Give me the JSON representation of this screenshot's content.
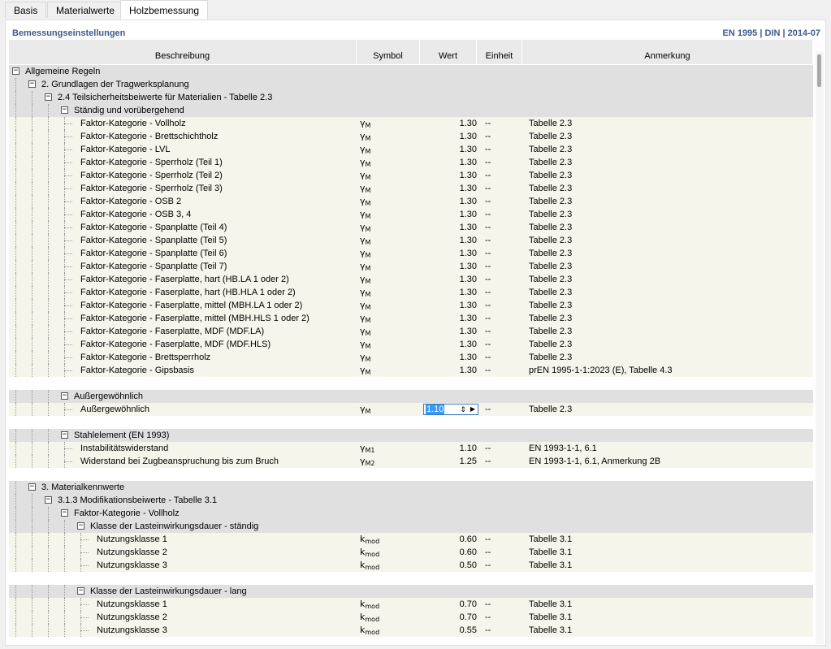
{
  "tabs": [
    {
      "label": "Basis",
      "active": false
    },
    {
      "label": "Materialwerte",
      "active": false
    },
    {
      "label": "Holzbemessung",
      "active": true
    }
  ],
  "panel": {
    "title": "Bemessungseinstellungen",
    "norm": "EN 1995 | DIN | 2014-07"
  },
  "columns": {
    "desc": "Beschreibung",
    "symbol": "Symbol",
    "value": "Wert",
    "unit": "Einheit",
    "note": "Anmerkung"
  },
  "rows": [
    {
      "type": "group",
      "level": 0,
      "text": "Allgemeine Regeln"
    },
    {
      "type": "group",
      "level": 1,
      "text": "2. Grundlagen der Tragwerksplanung"
    },
    {
      "type": "group",
      "level": 2,
      "text": "2.4 Teilsicherheitsbeiwerte für Materialien - Tabelle 2.3"
    },
    {
      "type": "group",
      "level": 3,
      "text": "Ständig und vorübergehend"
    },
    {
      "type": "data",
      "level": 4,
      "text": "Faktor-Kategorie - Vollholz",
      "sym": "γ",
      "sub": "M",
      "val": "1.30",
      "unit": "--",
      "note": "Tabelle 2.3"
    },
    {
      "type": "data",
      "level": 4,
      "text": "Faktor-Kategorie - Brettschichtholz",
      "sym": "γ",
      "sub": "M",
      "val": "1.30",
      "unit": "--",
      "note": "Tabelle 2.3"
    },
    {
      "type": "data",
      "level": 4,
      "text": "Faktor-Kategorie - LVL",
      "sym": "γ",
      "sub": "M",
      "val": "1.30",
      "unit": "--",
      "note": "Tabelle 2.3"
    },
    {
      "type": "data",
      "level": 4,
      "text": "Faktor-Kategorie - Sperrholz (Teil 1)",
      "sym": "γ",
      "sub": "M",
      "val": "1.30",
      "unit": "--",
      "note": "Tabelle 2.3"
    },
    {
      "type": "data",
      "level": 4,
      "text": "Faktor-Kategorie - Sperrholz (Teil 2)",
      "sym": "γ",
      "sub": "M",
      "val": "1.30",
      "unit": "--",
      "note": "Tabelle 2.3"
    },
    {
      "type": "data",
      "level": 4,
      "text": "Faktor-Kategorie - Sperrholz (Teil 3)",
      "sym": "γ",
      "sub": "M",
      "val": "1.30",
      "unit": "--",
      "note": "Tabelle 2.3"
    },
    {
      "type": "data",
      "level": 4,
      "text": "Faktor-Kategorie - OSB 2",
      "sym": "γ",
      "sub": "M",
      "val": "1.30",
      "unit": "--",
      "note": "Tabelle 2.3"
    },
    {
      "type": "data",
      "level": 4,
      "text": "Faktor-Kategorie - OSB 3, 4",
      "sym": "γ",
      "sub": "M",
      "val": "1.30",
      "unit": "--",
      "note": "Tabelle 2.3"
    },
    {
      "type": "data",
      "level": 4,
      "text": "Faktor-Kategorie - Spanplatte (Teil 4)",
      "sym": "γ",
      "sub": "M",
      "val": "1.30",
      "unit": "--",
      "note": "Tabelle 2.3"
    },
    {
      "type": "data",
      "level": 4,
      "text": "Faktor-Kategorie - Spanplatte (Teil 5)",
      "sym": "γ",
      "sub": "M",
      "val": "1.30",
      "unit": "--",
      "note": "Tabelle 2.3"
    },
    {
      "type": "data",
      "level": 4,
      "text": "Faktor-Kategorie - Spanplatte (Teil 6)",
      "sym": "γ",
      "sub": "M",
      "val": "1.30",
      "unit": "--",
      "note": "Tabelle 2.3"
    },
    {
      "type": "data",
      "level": 4,
      "text": "Faktor-Kategorie - Spanplatte (Teil 7)",
      "sym": "γ",
      "sub": "M",
      "val": "1.30",
      "unit": "--",
      "note": "Tabelle 2.3"
    },
    {
      "type": "data",
      "level": 4,
      "text": "Faktor-Kategorie - Faserplatte, hart (HB.LA 1 oder 2)",
      "sym": "γ",
      "sub": "M",
      "val": "1.30",
      "unit": "--",
      "note": "Tabelle 2.3"
    },
    {
      "type": "data",
      "level": 4,
      "text": "Faktor-Kategorie - Faserplatte, hart (HB.HLA 1 oder 2)",
      "sym": "γ",
      "sub": "M",
      "val": "1.30",
      "unit": "--",
      "note": "Tabelle 2.3"
    },
    {
      "type": "data",
      "level": 4,
      "text": "Faktor-Kategorie - Faserplatte, mittel (MBH.LA 1 oder 2)",
      "sym": "γ",
      "sub": "M",
      "val": "1.30",
      "unit": "--",
      "note": "Tabelle 2.3"
    },
    {
      "type": "data",
      "level": 4,
      "text": "Faktor-Kategorie - Faserplatte, mittel (MBH.HLS 1 oder 2)",
      "sym": "γ",
      "sub": "M",
      "val": "1.30",
      "unit": "--",
      "note": "Tabelle 2.3"
    },
    {
      "type": "data",
      "level": 4,
      "text": "Faktor-Kategorie - Faserplatte, MDF (MDF.LA)",
      "sym": "γ",
      "sub": "M",
      "val": "1.30",
      "unit": "--",
      "note": "Tabelle 2.3"
    },
    {
      "type": "data",
      "level": 4,
      "text": "Faktor-Kategorie - Faserplatte, MDF (MDF.HLS)",
      "sym": "γ",
      "sub": "M",
      "val": "1.30",
      "unit": "--",
      "note": "Tabelle 2.3"
    },
    {
      "type": "data",
      "level": 4,
      "text": "Faktor-Kategorie - Brettsperrholz",
      "sym": "γ",
      "sub": "M",
      "val": "1.30",
      "unit": "--",
      "note": "Tabelle 2.3"
    },
    {
      "type": "data",
      "level": 4,
      "text": "Faktor-Kategorie - Gipsbasis",
      "sym": "γ",
      "sub": "M",
      "val": "1.30",
      "unit": "--",
      "note": "prEN 1995-1-1:2023 (E), Tabelle 4.3"
    },
    {
      "type": "spacer"
    },
    {
      "type": "group",
      "level": 3,
      "text": "Außergewöhnlich"
    },
    {
      "type": "data",
      "level": 4,
      "text": "Außergewöhnlich",
      "sym": "γ",
      "sub": "M",
      "val": "1.10",
      "unit": "--",
      "note": "Tabelle 2.3",
      "editing": true
    },
    {
      "type": "spacer"
    },
    {
      "type": "group",
      "level": 3,
      "text": "Stahlelement (EN 1993)"
    },
    {
      "type": "data",
      "level": 4,
      "text": "Instabilitätswiderstand",
      "sym": "γ",
      "sub": "M1",
      "val": "1.10",
      "unit": "--",
      "note": "EN 1993-1-1, 6.1"
    },
    {
      "type": "data",
      "level": 4,
      "text": "Widerstand bei Zugbeanspruchung bis zum Bruch",
      "sym": "γ",
      "sub": "M2",
      "val": "1.25",
      "unit": "--",
      "note": "EN 1993-1-1, 6.1, Anmerkung 2B"
    },
    {
      "type": "spacer"
    },
    {
      "type": "group",
      "level": 1,
      "text": "3. Materialkennwerte"
    },
    {
      "type": "group",
      "level": 2,
      "text": "3.1.3 Modifikationsbeiwerte - Tabelle 3.1"
    },
    {
      "type": "group",
      "level": 3,
      "text": "Faktor-Kategorie - Vollholz"
    },
    {
      "type": "group",
      "level": 4,
      "text": "Klasse der Lasteinwirkungsdauer - ständig"
    },
    {
      "type": "data",
      "level": 5,
      "text": "Nutzungsklasse 1",
      "sym": "k",
      "sub": "mod",
      "val": "0.60",
      "unit": "--",
      "note": "Tabelle 3.1"
    },
    {
      "type": "data",
      "level": 5,
      "text": "Nutzungsklasse 2",
      "sym": "k",
      "sub": "mod",
      "val": "0.60",
      "unit": "--",
      "note": "Tabelle 3.1"
    },
    {
      "type": "data",
      "level": 5,
      "text": "Nutzungsklasse 3",
      "sym": "k",
      "sub": "mod",
      "val": "0.50",
      "unit": "--",
      "note": "Tabelle 3.1"
    },
    {
      "type": "spacer"
    },
    {
      "type": "group",
      "level": 4,
      "text": "Klasse der Lasteinwirkungsdauer - lang"
    },
    {
      "type": "data",
      "level": 5,
      "text": "Nutzungsklasse 1",
      "sym": "k",
      "sub": "mod",
      "val": "0.70",
      "unit": "--",
      "note": "Tabelle 3.1"
    },
    {
      "type": "data",
      "level": 5,
      "text": "Nutzungsklasse 2",
      "sym": "k",
      "sub": "mod",
      "val": "0.70",
      "unit": "--",
      "note": "Tabelle 3.1"
    },
    {
      "type": "data",
      "level": 5,
      "text": "Nutzungsklasse 3",
      "sym": "k",
      "sub": "mod",
      "val": "0.55",
      "unit": "--",
      "note": "Tabelle 3.1"
    }
  ]
}
